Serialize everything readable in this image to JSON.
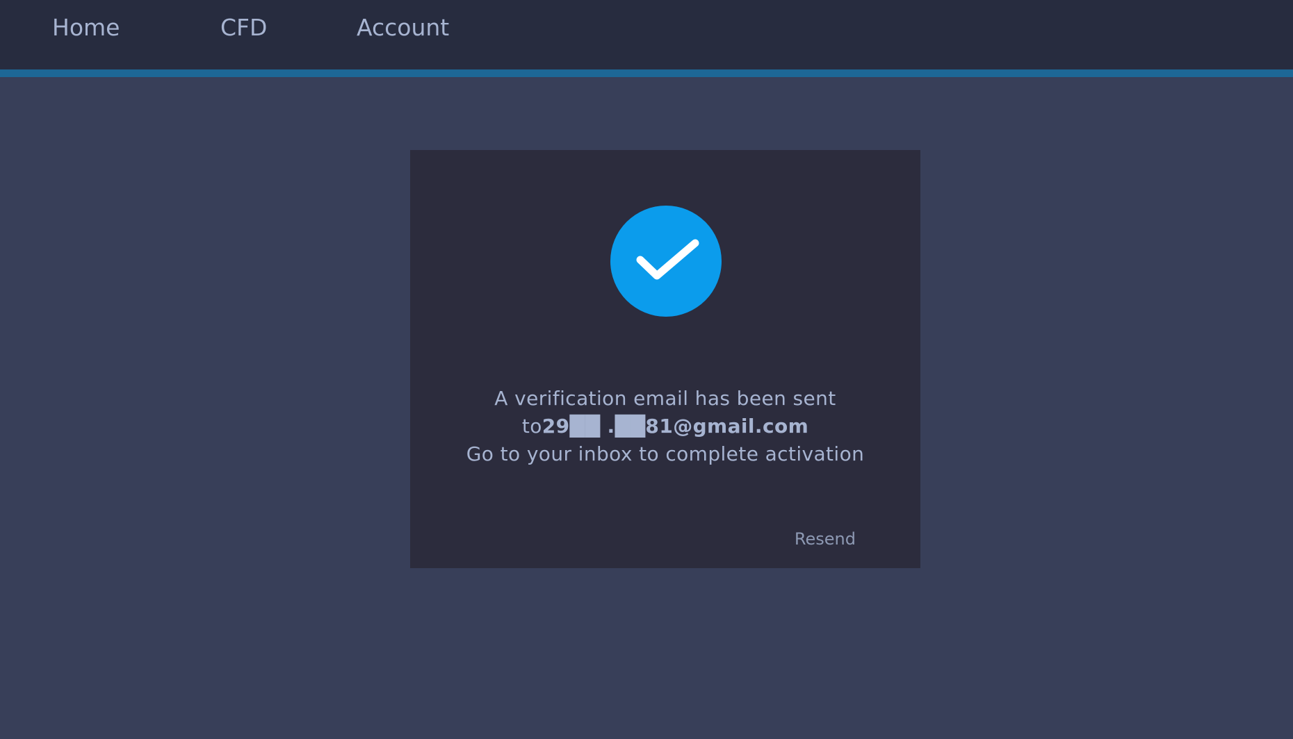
{
  "nav": {
    "home": "Home",
    "cfd": "CFD",
    "account": "Account"
  },
  "icon": {
    "name": "checkmark-icon",
    "color": "#0b9cec"
  },
  "message": {
    "line1": "A verification email has been sent",
    "to_prefix": "to",
    "email": "29██ .██81@gmail.com",
    "line3": "Go to your inbox to complete activation"
  },
  "actions": {
    "resend": "Resend"
  },
  "colors": {
    "nav_bg": "#272c3f",
    "accent": "#1d6796",
    "page_bg": "#383f59",
    "card_bg": "#2c2c3d",
    "text": "#a7b4d1"
  }
}
